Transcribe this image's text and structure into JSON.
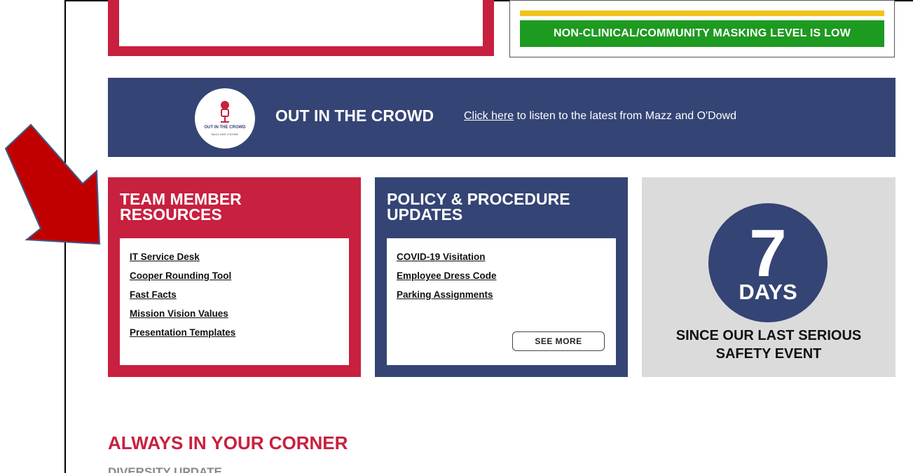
{
  "masking": {
    "status_text": "NON-CLINICAL/COMMUNITY MASKING LEVEL IS LOW",
    "colors": {
      "green": "#1d9a20",
      "yellow": "#f2c31b"
    }
  },
  "podcast": {
    "logo_text": "OUT IN THE CROWD",
    "logo_subtext": "MAZZ AND O'DOWD",
    "title": "OUT IN THE CROWD",
    "link_text": "Click here",
    "link_suffix": " to listen to the latest from Mazz and O'Dowd"
  },
  "team_resources": {
    "title": "TEAM MEMBER RESOURCES",
    "links": [
      "IT Service Desk",
      "Cooper Rounding Tool",
      "Fast Facts",
      "Mission Vision Values",
      "Presentation Templates"
    ]
  },
  "policy_updates": {
    "title": "POLICY & PROCEDURE UPDATES",
    "links": [
      "COVID-19 Visitation",
      "Employee Dress Code",
      "Parking Assignments"
    ],
    "see_more_label": "SEE MORE"
  },
  "safety": {
    "days_number": "7",
    "days_label": "DAYS",
    "since_text": "SINCE OUR LAST SERIOUS SAFETY EVENT"
  },
  "section": {
    "title": "ALWAYS IN YOUR CORNER",
    "subtitle": "DIVERSITY UPDATE"
  },
  "colors": {
    "red": "#c8203f",
    "navy": "#344474",
    "gray": "#dcdbdb"
  }
}
